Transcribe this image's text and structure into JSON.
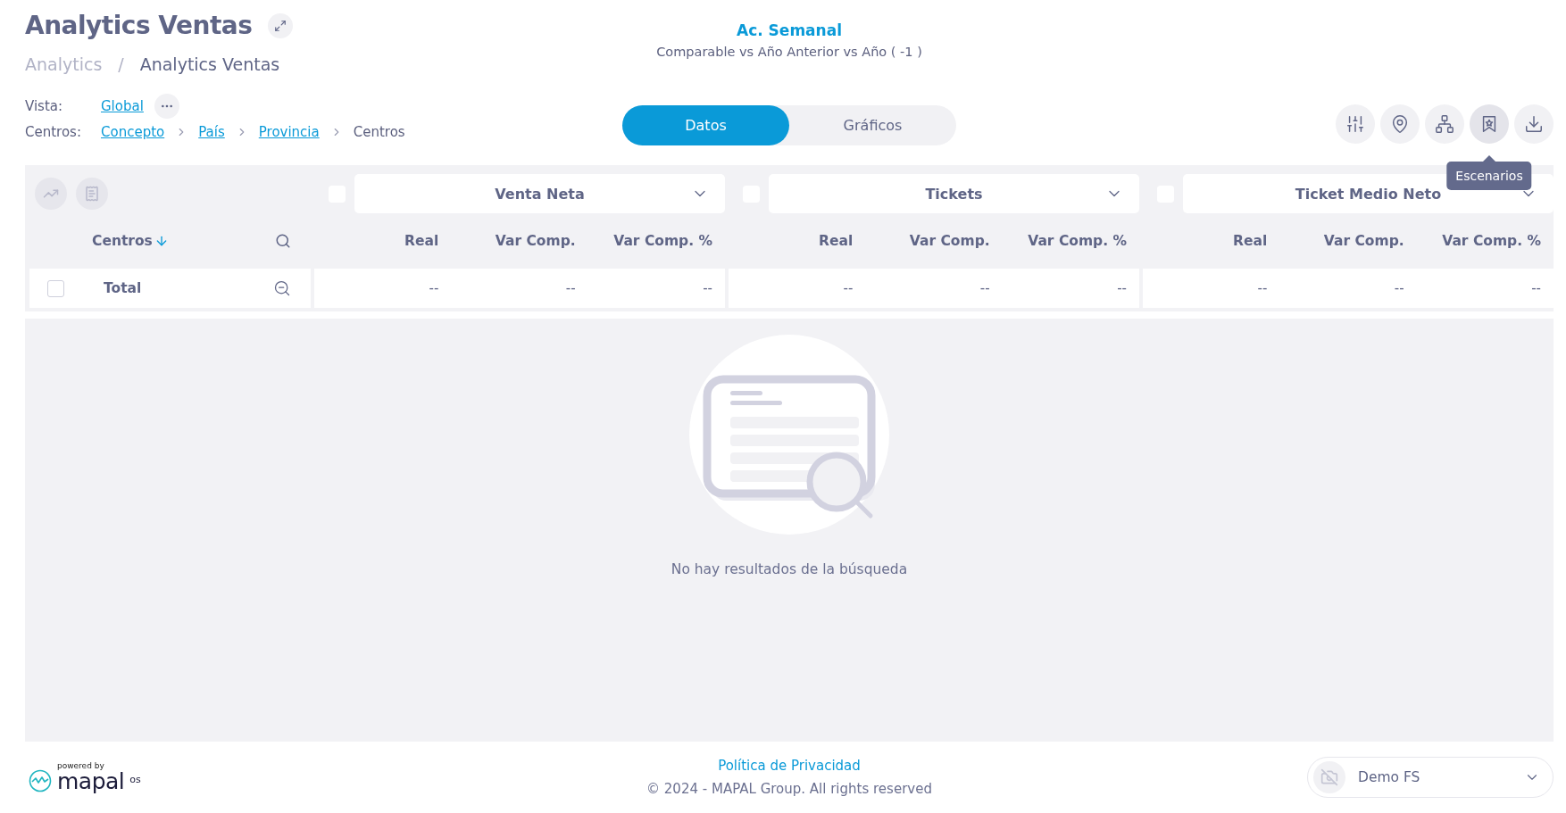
{
  "header": {
    "title": "Analytics Ventas",
    "breadcrumb_separator": "/",
    "breadcrumb": [
      {
        "label": "Analytics",
        "selected": false
      },
      {
        "label": "Analytics Ventas",
        "selected": true
      }
    ]
  },
  "period": {
    "title": "Ac. Semanal",
    "subtitle": "Comparable vs Año Anterior vs Año ( -1 )"
  },
  "vista": {
    "label": "Vista:",
    "value": "Global"
  },
  "centros": {
    "label": "Centros:",
    "path": [
      {
        "label": "Concepto",
        "link": true
      },
      {
        "label": "País",
        "link": true
      },
      {
        "label": "Provincia",
        "link": true
      },
      {
        "label": "Centros",
        "link": false
      }
    ]
  },
  "view_tabs": [
    {
      "label": "Datos",
      "selected": true
    },
    {
      "label": "Gráficos",
      "selected": false
    }
  ],
  "toolbar": [
    {
      "kind": "filters",
      "hovered": false
    },
    {
      "kind": "location",
      "hovered": false
    },
    {
      "kind": "hierarchy",
      "hovered": false
    },
    {
      "kind": "scenarios",
      "hovered": true,
      "tooltip": "Escenarios"
    },
    {
      "kind": "download",
      "hovered": false
    }
  ],
  "table": {
    "row_header": "Centros",
    "groups": [
      {
        "title": "Venta Neta",
        "checked": false,
        "columns": [
          "Real",
          "Var Comp.",
          "Var Comp. %"
        ]
      },
      {
        "title": "Tickets",
        "checked": false,
        "columns": [
          "Real",
          "Var Comp.",
          "Var Comp. %"
        ]
      },
      {
        "title": "Ticket Medio Neto",
        "checked": false,
        "columns": [
          "Real",
          "Var Comp.",
          "Var Comp. %"
        ]
      }
    ],
    "rows": [
      {
        "label": "Total",
        "checked": false,
        "cells": [
          [
            "--",
            "--",
            "--"
          ],
          [
            "--",
            "--",
            "--"
          ],
          [
            "--",
            "--",
            "--"
          ]
        ]
      }
    ]
  },
  "empty_state": {
    "message": "No hay resultados de la búsqueda"
  },
  "footer": {
    "powered_by": "powered by",
    "brand": "mapal",
    "brand_suffix": "os",
    "privacy_link": "Política de Privacidad",
    "copyright": "© 2024 - MAPAL Group. All rights reserved",
    "account": "Demo FS"
  }
}
